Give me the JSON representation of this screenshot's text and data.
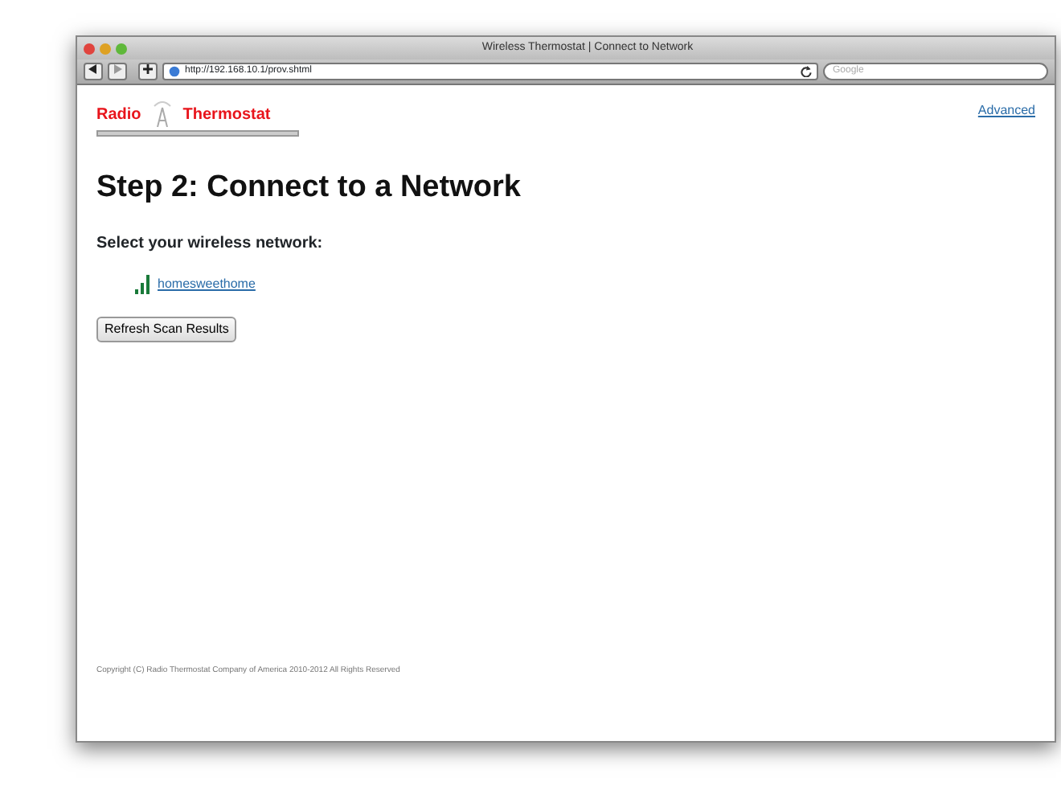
{
  "window": {
    "title": "Wireless Thermostat | Connect to Network"
  },
  "toolbar": {
    "url": "http://192.168.10.1/prov.shtml",
    "search_placeholder": "Google"
  },
  "logo": {
    "word_1": "Radio",
    "word_2": "Thermostat"
  },
  "header_link": "Advanced",
  "heading": "Step 2: Connect to a Network",
  "prompt": "Select your wireless network:",
  "networks": [
    {
      "name": "homesweethome"
    }
  ],
  "buttons": [
    "Refresh Scan Results"
  ],
  "footer": "Copyright (C) Radio Thermostat Company of America 2010-2012 All Rights Reserved"
}
